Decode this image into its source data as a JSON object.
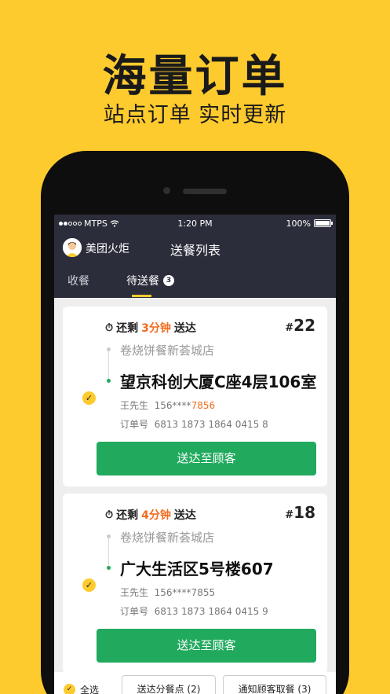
{
  "promo": {
    "headline": "海量订单",
    "subline": "站点订单 实时更新"
  },
  "status_bar": {
    "carrier": "MTPS",
    "time": "1:20 PM",
    "battery": "100%",
    "battery_level": 1.0
  },
  "app_bar": {
    "shop_name": "美团火炬",
    "title": "送餐列表"
  },
  "tabs": [
    {
      "label": "收餐"
    },
    {
      "label": "待送餐",
      "badge": "3"
    }
  ],
  "orders": [
    {
      "remain_prefix": "还剩",
      "remain_value": "3分钟",
      "remain_suffix": "送达",
      "hash": "#",
      "number": "22",
      "shop": "卷烧饼餐新荟城店",
      "address": "望京科创大厦C座4层106室",
      "customer_name": "王先生",
      "phone_head": "156****",
      "phone_tail": "7856",
      "order_label": "订单号",
      "order_id": "6813 1873 1864 0415 8",
      "button": "送达至顾客"
    },
    {
      "remain_prefix": "还剩",
      "remain_value": "4分钟",
      "remain_suffix": "送达",
      "hash": "#",
      "number": "18",
      "shop": "卷烧饼餐新荟城店",
      "address": "广大生活区5号楼607",
      "customer_name": "王先生",
      "phone_head": "156****7855",
      "phone_tail": "",
      "order_label": "订单号",
      "order_id": "6813 1873 1864 0415 9",
      "button": "送达至顾客"
    }
  ],
  "bottom_bar": {
    "select_all": "全选",
    "deliver_pickup": "送达分餐点 (2)",
    "notify_customer": "通知顾客取餐 (3)"
  },
  "colors": {
    "brand_yellow": "#FECB2E",
    "dark_bar": "#2B2D3A",
    "green": "#21AA5E",
    "orange": "#F26B1D"
  }
}
